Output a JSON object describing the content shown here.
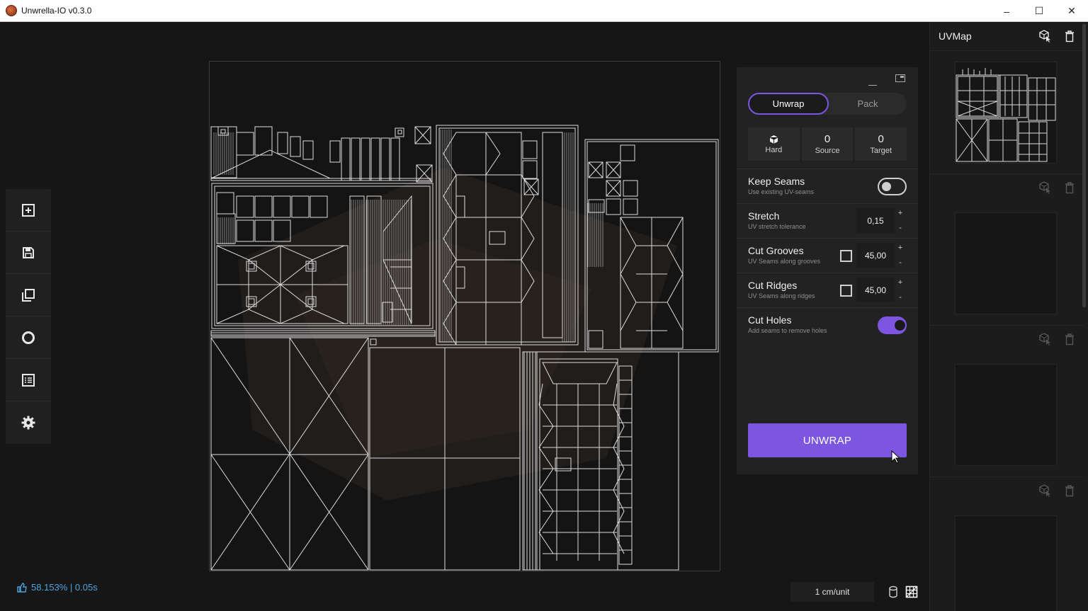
{
  "window": {
    "title": "Unwrella-IO v0.3.0",
    "minimize_glyph": "–",
    "maximize_glyph": "☐",
    "close_glyph": "✕"
  },
  "left_toolbar": {
    "items": [
      "add-icon",
      "save-icon",
      "copy-icon",
      "circle-icon",
      "list-icon",
      "gear-icon"
    ]
  },
  "status": {
    "text": "58.153% | 0.05s",
    "icon": "thumbs-up-icon",
    "color": "#4aa3e0"
  },
  "bottom": {
    "scale": "1 cm/unit"
  },
  "panel": {
    "tabs": [
      {
        "label": "Unwrap",
        "active": true
      },
      {
        "label": "Pack",
        "active": false
      }
    ],
    "stats": [
      {
        "value": "",
        "label": "Hard",
        "icon": "cube-icon"
      },
      {
        "value": "0",
        "label": "Source"
      },
      {
        "value": "0",
        "label": "Target"
      }
    ],
    "rows": [
      {
        "name": "Keep Seams",
        "hint": "Use existing UV-seams",
        "control": "toggle",
        "on": false
      },
      {
        "name": "Stretch",
        "hint": "UV stretch tolerance",
        "control": "number",
        "value": "0,15"
      },
      {
        "name": "Cut Grooves",
        "hint": "UV Seams along grooves",
        "control": "check-number",
        "value": "45,00"
      },
      {
        "name": "Cut Ridges",
        "hint": "UV Seams along ridges",
        "control": "check-number",
        "value": "45,00"
      },
      {
        "name": "Cut Holes",
        "hint": "Add seams to remove holes",
        "control": "toggle",
        "on": true
      }
    ],
    "stepper_plus": "+",
    "stepper_minus": "-",
    "unwrap_label": "UNWRAP",
    "accent": "#7c55e0"
  },
  "sidebar": {
    "title": "UVMap"
  }
}
